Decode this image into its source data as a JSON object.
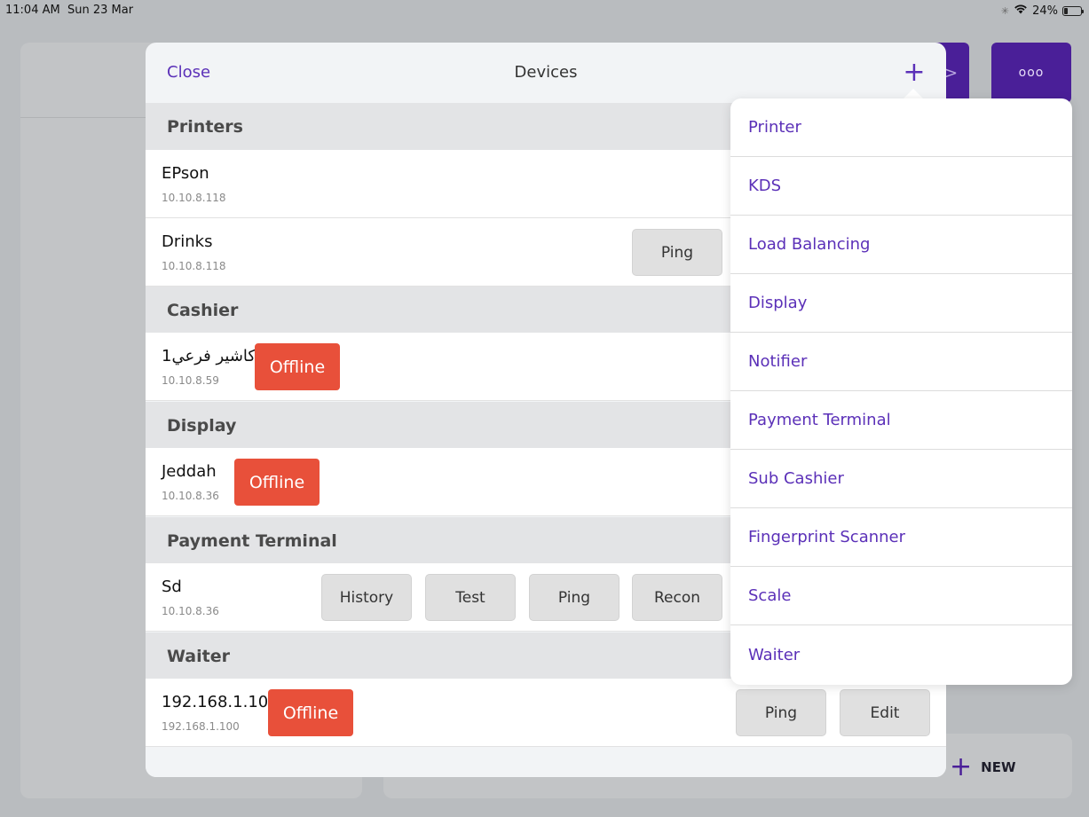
{
  "status_bar": {
    "time": "11:04 AM",
    "date": "Sun 23 Mar",
    "battery": "24%",
    "battery_level": 0.24
  },
  "background": {
    "more_label": "ooo",
    "new_label": "NEW"
  },
  "modal": {
    "close_label": "Close",
    "title": "Devices",
    "add_glyph": "+"
  },
  "sections": {
    "printers": {
      "title": "Printers",
      "rows": [
        {
          "name": "EPson",
          "ip": "10.10.8.118"
        },
        {
          "name": "Drinks",
          "ip": "10.10.8.118",
          "ping_label": "Ping"
        }
      ]
    },
    "cashier": {
      "title": "Cashier",
      "rows": [
        {
          "name": "1كاشير فرعي",
          "ip": "10.10.8.59",
          "status": "Offline"
        }
      ]
    },
    "display": {
      "title": "Display",
      "rows": [
        {
          "name": "Jeddah",
          "ip": "10.10.8.36",
          "status": "Offline"
        }
      ]
    },
    "payment_terminal": {
      "title": "Payment Terminal",
      "rows": [
        {
          "name": "Sd",
          "ip": "10.10.8.36",
          "history_label": "History",
          "test_label": "Test",
          "ping_label": "Ping",
          "recon_label": "Recon"
        }
      ]
    },
    "waiter": {
      "title": "Waiter",
      "rows": [
        {
          "name": "192.168.1.100",
          "ip": "192.168.1.100",
          "status": "Offline",
          "ping_label": "Ping",
          "edit_label": "Edit"
        }
      ]
    }
  },
  "add_menu": {
    "items": [
      "Printer",
      "KDS",
      "Load Balancing",
      "Display",
      "Notifier",
      "Payment Terminal",
      "Sub Cashier",
      "Fingerprint Scanner",
      "Scale",
      "Waiter"
    ]
  },
  "colors": {
    "accent": "#5b30b8",
    "offline": "#e8503a",
    "section_bg": "#e3e4e6",
    "background_purple": "#4a1f98"
  }
}
